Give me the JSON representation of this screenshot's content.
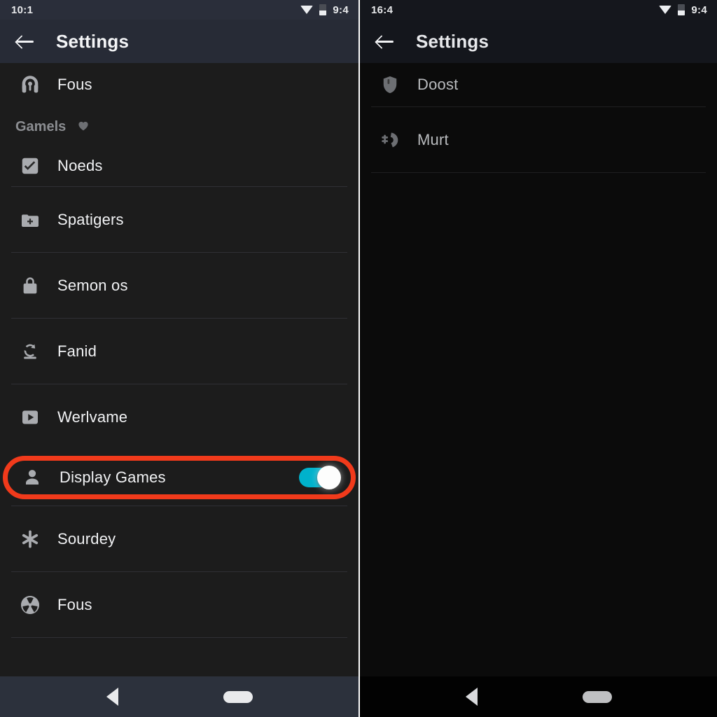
{
  "accent": {
    "toggle_on": "#00b2cc",
    "highlight_border": "#f13a1b",
    "text_primary": "#f1f2f4",
    "text_muted": "#8b8d91",
    "icon_grey": "#a9abaf"
  },
  "left_screen": {
    "status_bar": {
      "clock": "10:1",
      "wifi_icon": "wifi-icon",
      "battery_icon": "battery-icon",
      "right_clock": "9:4"
    },
    "app_bar": {
      "back_icon": "back-arrow-icon",
      "title": "Settings"
    },
    "top_item": {
      "icon": "headphones-icon",
      "label": "Fous"
    },
    "section": {
      "title": "Gamels",
      "icon": "heart-icon"
    },
    "items": [
      {
        "icon": "checkbox-checked-icon",
        "label": "Noeds",
        "toggle": null
      },
      {
        "icon": "add-box-icon",
        "label": "Spatigers",
        "toggle": null
      },
      {
        "icon": "lock-icon",
        "label": "Semon os",
        "toggle": null
      },
      {
        "icon": "rotate-icon",
        "label": "Fanid",
        "toggle": null
      },
      {
        "icon": "play-box-icon",
        "label": "Werlvame",
        "toggle": null
      },
      {
        "icon": "person-icon",
        "label": "Display Games",
        "toggle": "on",
        "highlighted": true
      },
      {
        "icon": "asterisk-icon",
        "label": "Sourdey",
        "toggle": null
      },
      {
        "icon": "pinwheel-icon",
        "label": "Fous",
        "toggle": null
      }
    ],
    "nav_bar": {
      "back_icon": "nav-back-triangle-icon",
      "home_icon": "nav-home-pill-icon"
    }
  },
  "right_screen": {
    "status_bar": {
      "clock": "16:4",
      "wifi_icon": "wifi-icon",
      "battery_icon": "battery-icon",
      "right_clock": "9:4"
    },
    "app_bar": {
      "back_icon": "back-arrow-icon",
      "title": "Settings"
    },
    "items": [
      {
        "icon": "shield-icon",
        "label": "Doost"
      },
      {
        "icon": "network-icon",
        "label": "Murt"
      }
    ],
    "nav_bar": {
      "back_icon": "nav-back-triangle-icon",
      "home_icon": "nav-home-pill-icon"
    }
  }
}
